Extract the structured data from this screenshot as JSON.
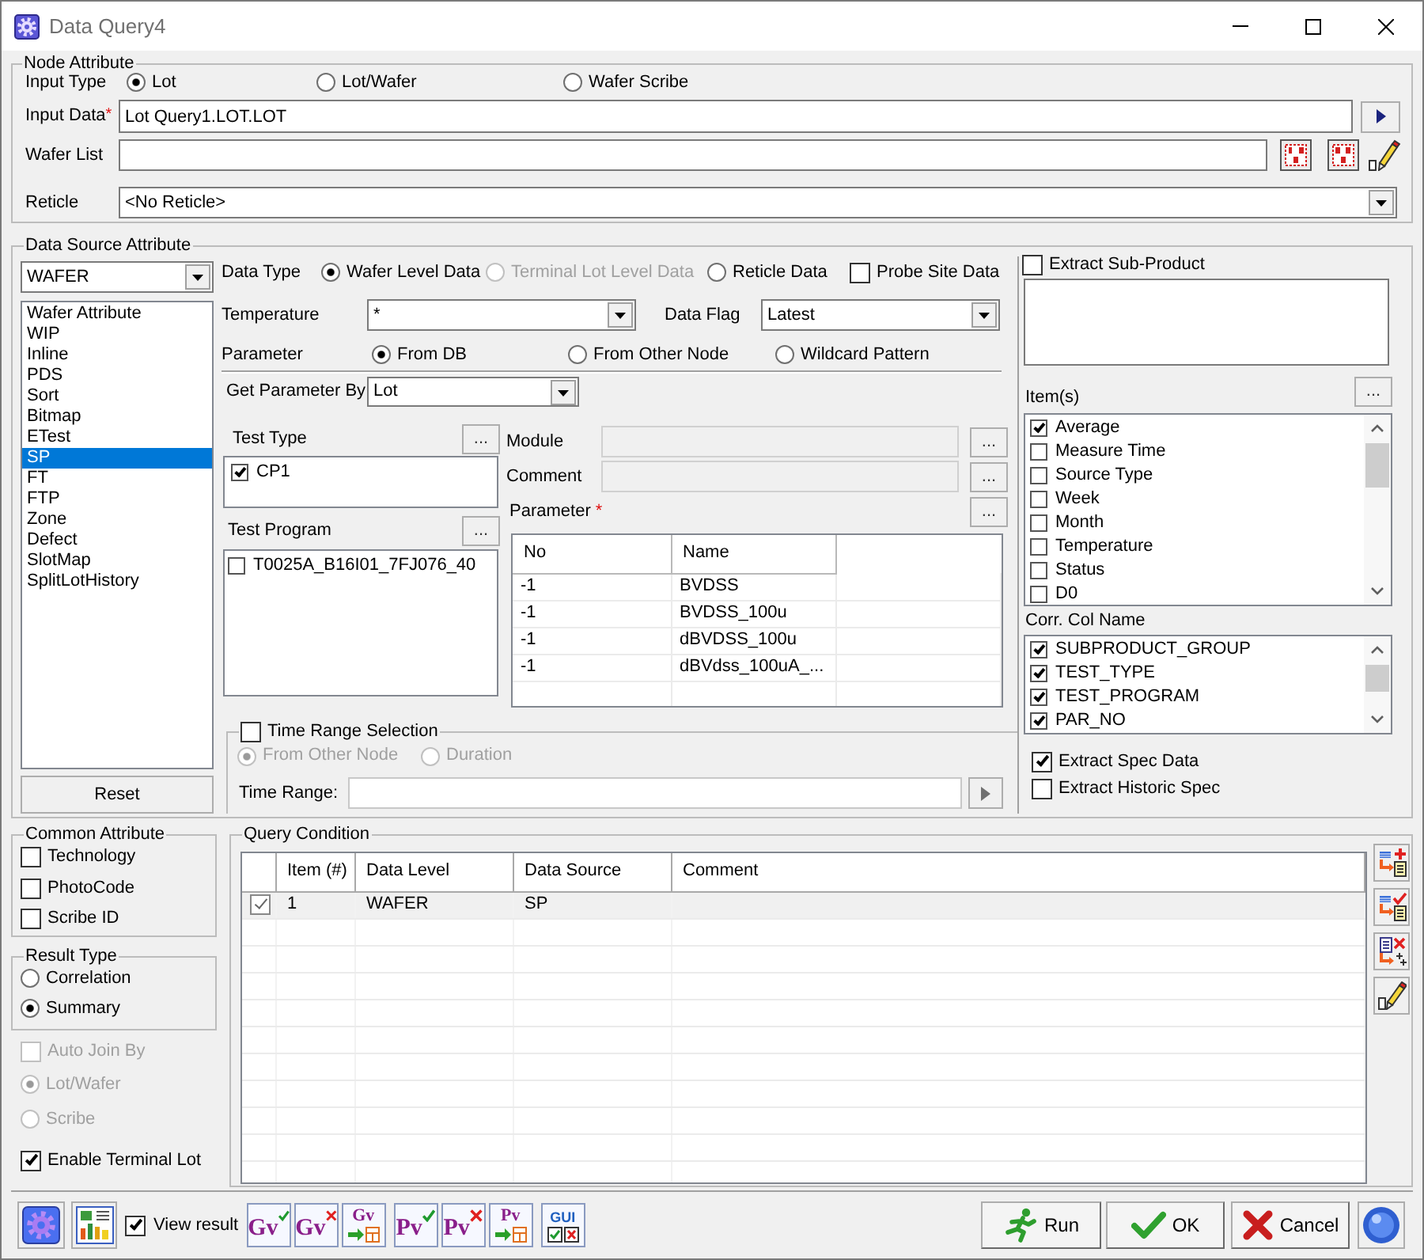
{
  "window": {
    "title": "Data Query4"
  },
  "node_attribute": {
    "title": "Node Attribute",
    "input_type": {
      "label": "Input Type",
      "options": [
        {
          "label": "Lot",
          "selected": true
        },
        {
          "label": "Lot/Wafer",
          "selected": false
        },
        {
          "label": "Wafer Scribe",
          "selected": false
        }
      ]
    },
    "input_data": {
      "label": "Input Data",
      "required_mark": "*",
      "value": "Lot Query1.LOT.LOT"
    },
    "wafer_list": {
      "label": "Wafer List"
    },
    "reticle": {
      "label": "Reticle",
      "value": "<No Reticle>"
    }
  },
  "data_source_attribute": {
    "title": "Data Source Attribute",
    "level": "WAFER",
    "sources": [
      {
        "label": "Wafer Attribute",
        "selected": false
      },
      {
        "label": "WIP",
        "selected": false
      },
      {
        "label": "Inline",
        "selected": false
      },
      {
        "label": "PDS",
        "selected": false
      },
      {
        "label": "Sort",
        "selected": false
      },
      {
        "label": "Bitmap",
        "selected": false
      },
      {
        "label": "ETest",
        "selected": false
      },
      {
        "label": "SP",
        "selected": true
      },
      {
        "label": "FT",
        "selected": false
      },
      {
        "label": "FTP",
        "selected": false
      },
      {
        "label": "Zone",
        "selected": false
      },
      {
        "label": "Defect",
        "selected": false
      },
      {
        "label": "SlotMap",
        "selected": false
      },
      {
        "label": "SplitLotHistory",
        "selected": false
      }
    ],
    "reset_button": "Reset",
    "data_type": {
      "label": "Data Type",
      "options": [
        {
          "label": "Wafer Level Data",
          "selected": true,
          "disabled": false
        },
        {
          "label": "Terminal Lot Level Data",
          "selected": false,
          "disabled": true
        },
        {
          "label": "Reticle Data",
          "selected": false,
          "disabled": false
        }
      ]
    },
    "probe_site_data": {
      "label": "Probe Site Data",
      "checked": false
    },
    "temperature": {
      "label": "Temperature",
      "value": "*"
    },
    "data_flag": {
      "label": "Data Flag",
      "value": "Latest"
    },
    "parameter_source": {
      "label": "Parameter",
      "options": [
        {
          "label": "From DB",
          "selected": true
        },
        {
          "label": "From Other Node",
          "selected": false
        },
        {
          "label": "Wildcard Pattern",
          "selected": false
        }
      ]
    },
    "get_parameter_by": {
      "label": "Get Parameter By",
      "value": "Lot"
    },
    "test_type": {
      "label": "Test Type",
      "more_button": "...",
      "items": [
        {
          "label": "CP1",
          "checked": true
        }
      ]
    },
    "test_program": {
      "label": "Test Program",
      "more_button": "...",
      "items": [
        {
          "label": "T0025A_B16I01_7FJ076_40",
          "checked": false
        }
      ]
    },
    "module": {
      "label": "Module",
      "disabled": true,
      "more_button": "..."
    },
    "comment": {
      "label": "Comment",
      "disabled": true,
      "more_button": "..."
    },
    "parameter": {
      "label": "Parameter",
      "required_mark": "*",
      "more_button": "...",
      "columns": [
        "No",
        "Name"
      ],
      "rows": [
        {
          "no": "-1",
          "name": "BVDSS"
        },
        {
          "no": "-1",
          "name": "BVDSS_100u"
        },
        {
          "no": "-1",
          "name": "dBVDSS_100u"
        },
        {
          "no": "-1",
          "name": "dBVdss_100uA_..."
        }
      ]
    },
    "time_range": {
      "label": "Time Range Selection",
      "checked": false,
      "options": [
        {
          "label": "From Other Node",
          "selected": true,
          "disabled": true
        },
        {
          "label": "Duration",
          "selected": false,
          "disabled": true
        }
      ],
      "field_label": "Time Range:"
    },
    "extract_sub_product": {
      "label": "Extract Sub-Product",
      "checked": false
    },
    "items": {
      "label": "Item(s)",
      "more_button": "...",
      "list": [
        {
          "label": "Average",
          "checked": true
        },
        {
          "label": "Measure Time",
          "checked": false
        },
        {
          "label": "Source Type",
          "checked": false
        },
        {
          "label": "Week",
          "checked": false
        },
        {
          "label": "Month",
          "checked": false
        },
        {
          "label": "Temperature",
          "checked": false
        },
        {
          "label": "Status",
          "checked": false
        },
        {
          "label": "D0",
          "checked": false
        }
      ]
    },
    "corr_col_name": {
      "label": "Corr. Col Name",
      "list": [
        {
          "label": "SUBPRODUCT_GROUP",
          "checked": true
        },
        {
          "label": "TEST_TYPE",
          "checked": true
        },
        {
          "label": "TEST_PROGRAM",
          "checked": true
        },
        {
          "label": "PAR_NO",
          "checked": true
        }
      ]
    },
    "extract_spec_data": {
      "label": "Extract Spec Data",
      "checked": true
    },
    "extract_historic_spec": {
      "label": "Extract Historic Spec",
      "checked": false
    }
  },
  "common_attribute": {
    "title": "Common Attribute",
    "options": [
      {
        "label": "Technology",
        "checked": false
      },
      {
        "label": "PhotoCode",
        "checked": false
      },
      {
        "label": "Scribe ID",
        "checked": false
      }
    ]
  },
  "result_type": {
    "title": "Result Type",
    "options": [
      {
        "label": "Correlation",
        "selected": false
      },
      {
        "label": "Summary",
        "selected": true
      }
    ]
  },
  "auto_join_by": {
    "label": "Auto Join By",
    "checked": false,
    "disabled": true,
    "options": [
      {
        "label": "Lot/Wafer",
        "selected": true,
        "disabled": true
      },
      {
        "label": "Scribe",
        "selected": false,
        "disabled": true
      }
    ]
  },
  "enable_terminal_lot": {
    "label": "Enable Terminal Lot",
    "checked": true
  },
  "query_condition": {
    "title": "Query Condition",
    "columns": [
      "Item (#)",
      "Data Level",
      "Data Source",
      "Comment"
    ],
    "rows": [
      {
        "checked": true,
        "selected": true,
        "item": "1",
        "data_level": "WAFER",
        "data_source": "SP"
      }
    ]
  },
  "toolbar": {
    "view_result": {
      "label": "View result",
      "checked": true
    },
    "tools": [
      {
        "text": "Gv",
        "kind": "accept"
      },
      {
        "text": "Gv",
        "kind": "reject"
      },
      {
        "text": "Gv",
        "kind": "export"
      },
      {
        "text": "Pv",
        "kind": "accept"
      },
      {
        "text": "Pv",
        "kind": "reject"
      },
      {
        "text": "Pv",
        "kind": "export"
      },
      {
        "text": "GUI",
        "kind": "gui"
      }
    ],
    "actions": [
      {
        "label": "Run",
        "kind": "run"
      },
      {
        "label": "OK",
        "kind": "ok"
      },
      {
        "label": "Cancel",
        "kind": "cancel"
      }
    ]
  }
}
